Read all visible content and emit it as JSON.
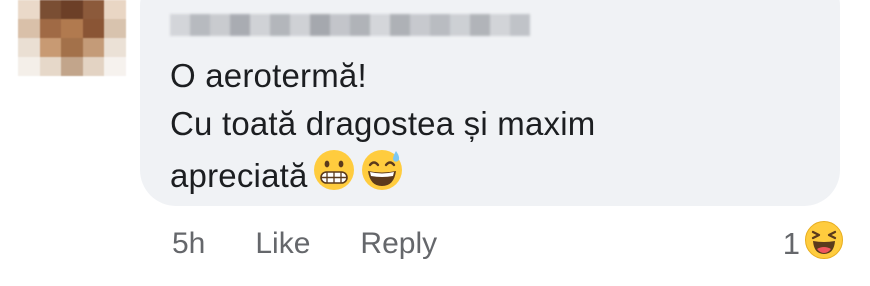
{
  "comment": {
    "author_name": "",
    "lines": [
      "O aerotermă!",
      "Cu toată dragostea și maxim",
      "apreciată"
    ],
    "emojis": [
      "grimacing-face-icon",
      "grinning-sweat-face-icon"
    ]
  },
  "actions": {
    "time": "5h",
    "like_label": "Like",
    "reply_label": "Reply"
  },
  "reactions": {
    "count": "1",
    "icon": "laughing-face-icon"
  },
  "colors": {
    "bubble": "#f0f2f5",
    "text": "#1c1e21",
    "secondary_text": "#65676b",
    "emoji_yellow": "#ffcc3e"
  }
}
